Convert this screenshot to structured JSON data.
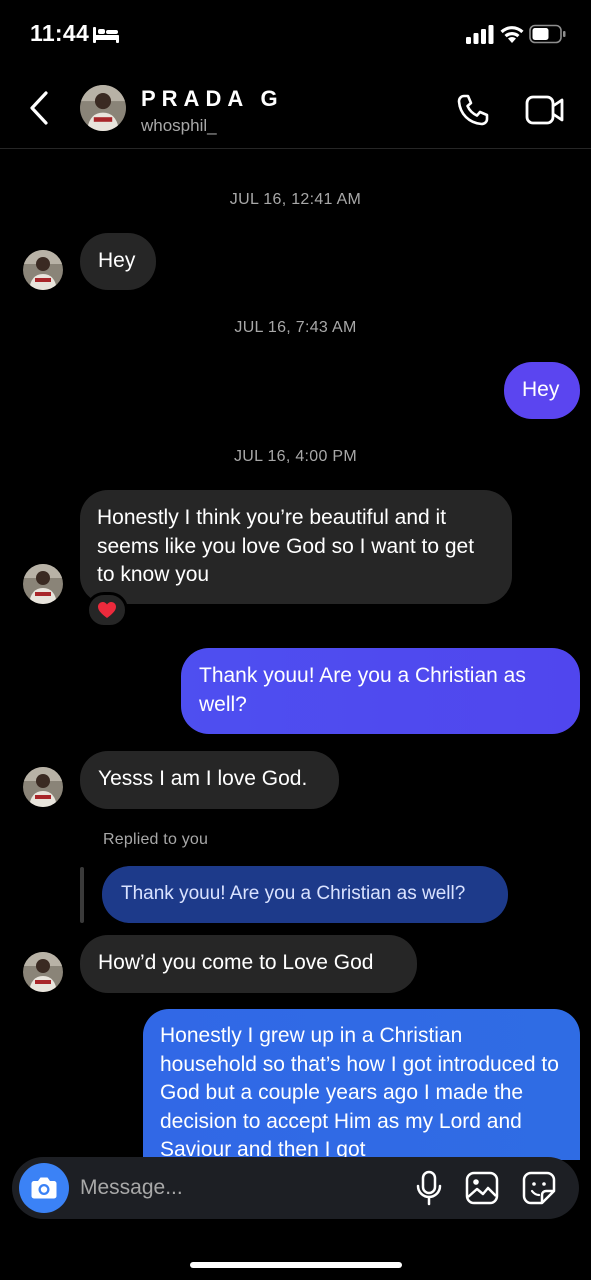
{
  "status_bar": {
    "time": "11:44",
    "icons": [
      "bed-icon",
      "cellular-signal-icon",
      "wifi-icon",
      "battery-icon"
    ]
  },
  "header": {
    "name": "PRADA G",
    "username": "whosphil_",
    "icons": [
      "back-arrow-icon",
      "phone-icon",
      "video-camera-icon"
    ]
  },
  "thread": {
    "timestamps": [
      "JUL 16, 12:41 AM",
      "JUL 16, 7:43 AM",
      "JUL 16, 4:00 PM"
    ],
    "messages": [
      {
        "from": "them",
        "text": "Hey"
      },
      {
        "from": "me",
        "text": "Hey"
      },
      {
        "from": "them",
        "text": "Honestly I think you’re beautiful and it seems like you love God so I want to get to know you",
        "reaction": "❤️"
      },
      {
        "from": "me",
        "text": "Thank youu! Are you a Christian as well?"
      },
      {
        "from": "them",
        "text": "Yesss I am I love God."
      },
      {
        "from": "them",
        "text": "How’d you come to Love God",
        "reply_label": "Replied to you",
        "reply_quote": "Thank youu! Are you a Christian as well?"
      },
      {
        "from": "me",
        "text": "Honestly I grew up in a Christian household so that’s how I got introduced to God but a couple years ago I made the decision to accept Him as my Lord and Saviour and then I got"
      }
    ]
  },
  "composer": {
    "placeholder": "Message...",
    "icons": [
      "camera-icon",
      "microphone-icon",
      "gallery-icon",
      "sticker-icon"
    ]
  },
  "colors": {
    "background": "#000000",
    "incoming_bubble": "#262626",
    "outgoing_gradient": [
      "#5b45f0",
      "#3167e6"
    ],
    "reply_quote_bubble": "#1d3a8a",
    "camera_button": "#3b82f6"
  }
}
